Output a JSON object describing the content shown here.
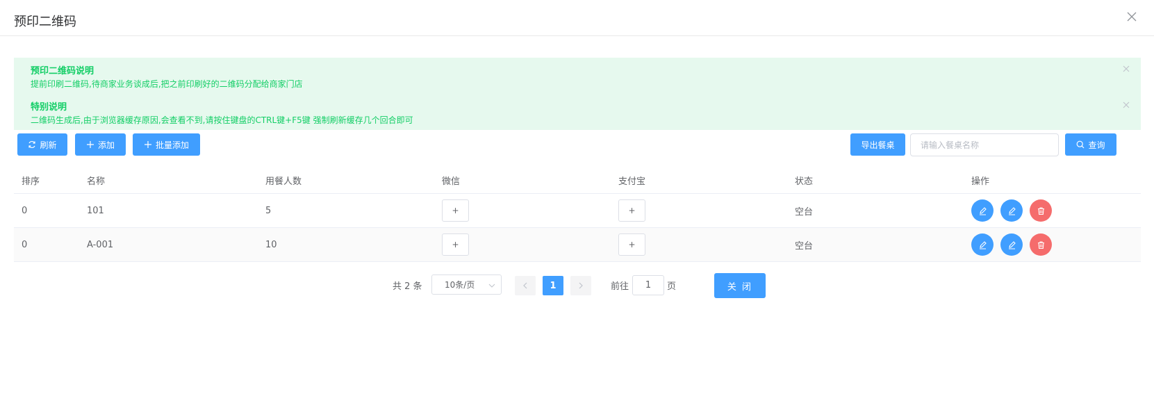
{
  "dialog": {
    "title": "预印二维码"
  },
  "alerts": [
    {
      "title": "预印二维码说明",
      "desc": "提前印刷二维码,待商家业务谈成后,把之前印刷好的二维码分配给商家门店"
    },
    {
      "title": "特别说明",
      "desc": "二维码生成后,由于浏览器缓存原因,会查看不到,请按住键盘的CTRL键+F5键 强制刷新缓存几个回合即可"
    }
  ],
  "toolbar": {
    "refresh_label": "刷新",
    "add_label": "添加",
    "batch_add_label": "批量添加",
    "export_label": "导出餐桌",
    "search_placeholder": "请输入餐桌名称",
    "search_label": "查询"
  },
  "table": {
    "columns": [
      "排序",
      "名称",
      "用餐人数",
      "微信",
      "支付宝",
      "状态",
      "操作"
    ],
    "rows": [
      {
        "sort": "0",
        "name": "101",
        "people": "5",
        "wechat": "+",
        "alipay": "+",
        "status": "空台"
      },
      {
        "sort": "0",
        "name": "A-001",
        "people": "10",
        "wechat": "+",
        "alipay": "+",
        "status": "空台"
      }
    ]
  },
  "pagination": {
    "total": "共 2 条",
    "page_size": "10条/页",
    "current_page": "1",
    "goto_label": "前往",
    "goto_value": "1",
    "goto_unit": "页"
  },
  "close_button_label": "关 闭",
  "colors": {
    "primary": "#409eff",
    "danger": "#f56c6c",
    "success_text": "#13ce66",
    "success_bg": "#e6f9ee"
  }
}
